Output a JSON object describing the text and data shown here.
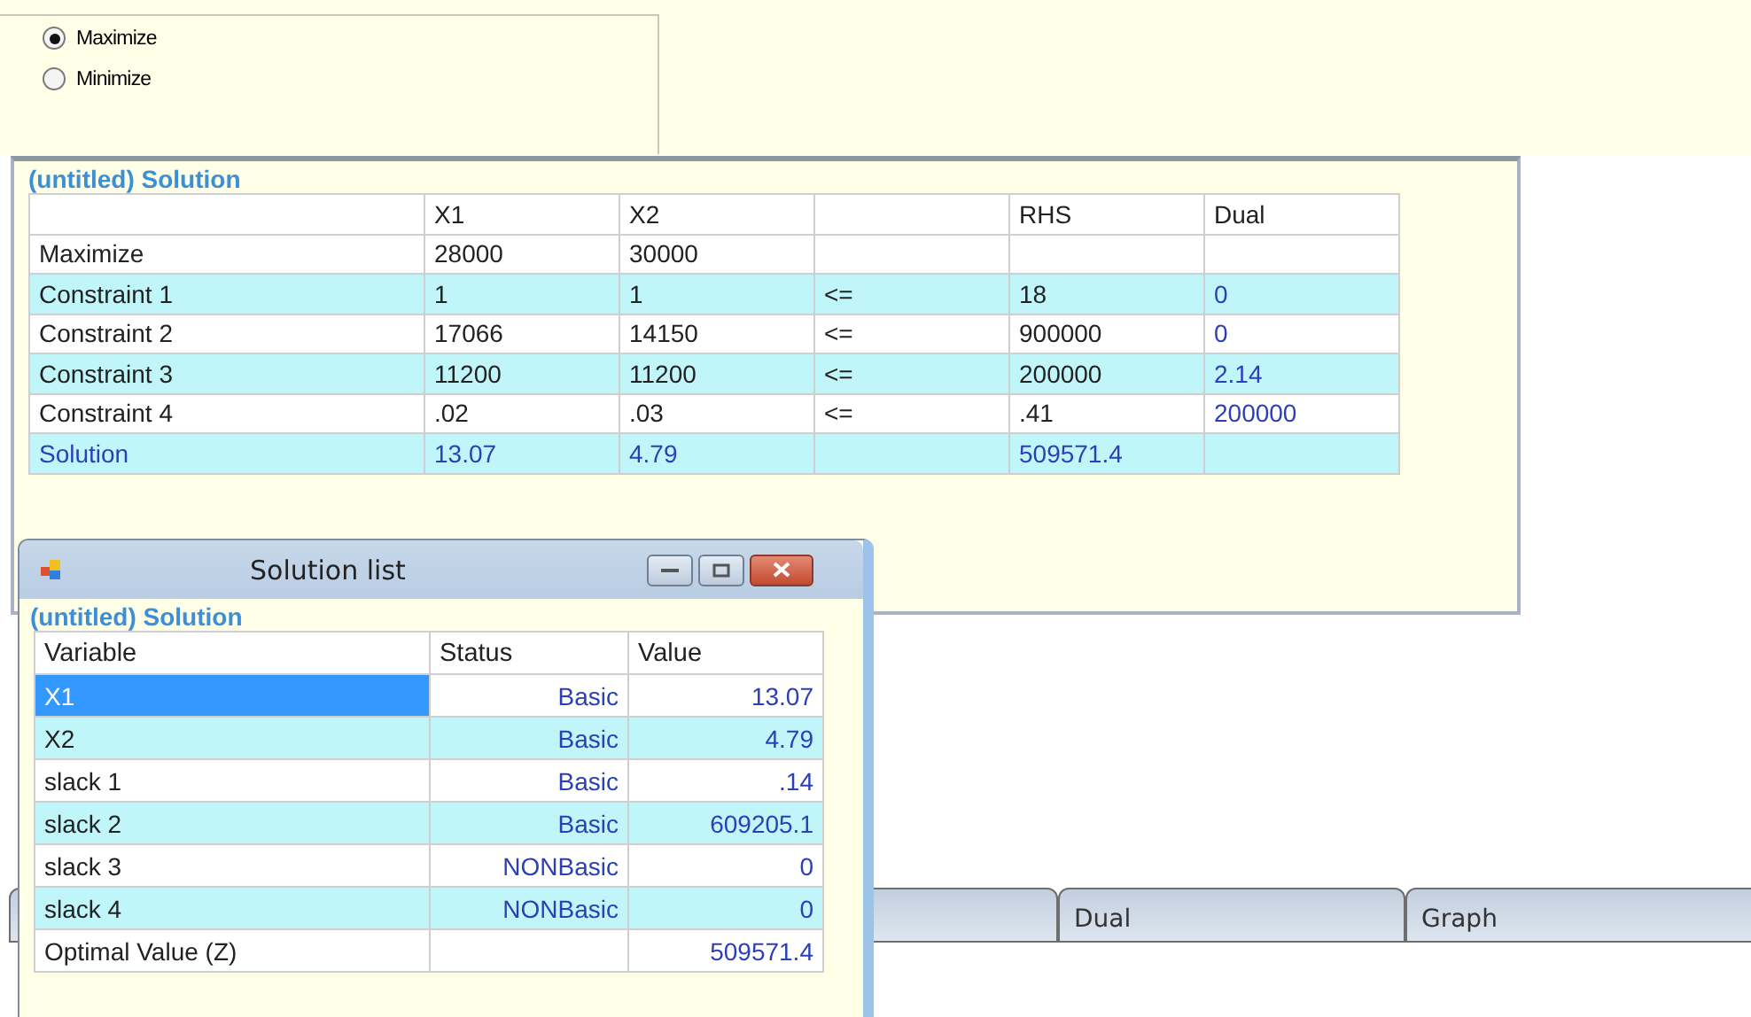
{
  "objective": {
    "options": [
      {
        "label": "Maximize",
        "selected": true
      },
      {
        "label": "Minimize",
        "selected": false
      }
    ]
  },
  "solution_window": {
    "heading": "(untitled) Solution",
    "columns": [
      {},
      {
        "label": "X1"
      },
      {
        "label": "X2"
      },
      {},
      {
        "label": "RHS"
      },
      {
        "label": "Dual"
      }
    ],
    "rows": [
      {
        "kind": "objective",
        "cells": [
          "Maximize",
          "28000",
          "30000",
          null,
          null,
          null
        ]
      },
      {
        "kind": "constraint",
        "cells": [
          "Constraint 1",
          "1",
          "1",
          "<=",
          "18",
          "0"
        ]
      },
      {
        "kind": "constraint",
        "cells": [
          "Constraint 2",
          "17066",
          "14150",
          "<=",
          "900000",
          "0"
        ]
      },
      {
        "kind": "constraint",
        "cells": [
          "Constraint 3",
          "11200",
          "11200",
          "<=",
          "200000",
          "2.14"
        ]
      },
      {
        "kind": "constraint",
        "cells": [
          "Constraint 4",
          ".02",
          ".03",
          "<=",
          ".41",
          "200000"
        ]
      },
      {
        "kind": "solution",
        "cells": [
          "Solution",
          "13.07",
          "4.79",
          null,
          "509571.4",
          null
        ]
      }
    ]
  },
  "tabs": [
    {
      "label": "Dual"
    },
    {
      "label": "Graph"
    }
  ],
  "solution_list": {
    "title": "Solution list",
    "heading": "(untitled) Solution",
    "columns": [
      "Variable",
      "Status",
      "Value"
    ],
    "rows": [
      {
        "variable": "X1",
        "status": "Basic",
        "value": "13.07",
        "selected": true
      },
      {
        "variable": "X2",
        "status": "Basic",
        "value": "4.79",
        "selected": false
      },
      {
        "variable": "slack 1",
        "status": "Basic",
        "value": ".14",
        "selected": false
      },
      {
        "variable": "slack 2",
        "status": "Basic",
        "value": "609205.1",
        "selected": false
      },
      {
        "variable": "slack 3",
        "status": "NONBasic",
        "value": "0",
        "selected": false
      },
      {
        "variable": "slack 4",
        "status": "NONBasic",
        "value": "0",
        "selected": false
      },
      {
        "variable": "Optimal Value (Z)",
        "value": "509571.4",
        "selected": false
      }
    ]
  }
}
